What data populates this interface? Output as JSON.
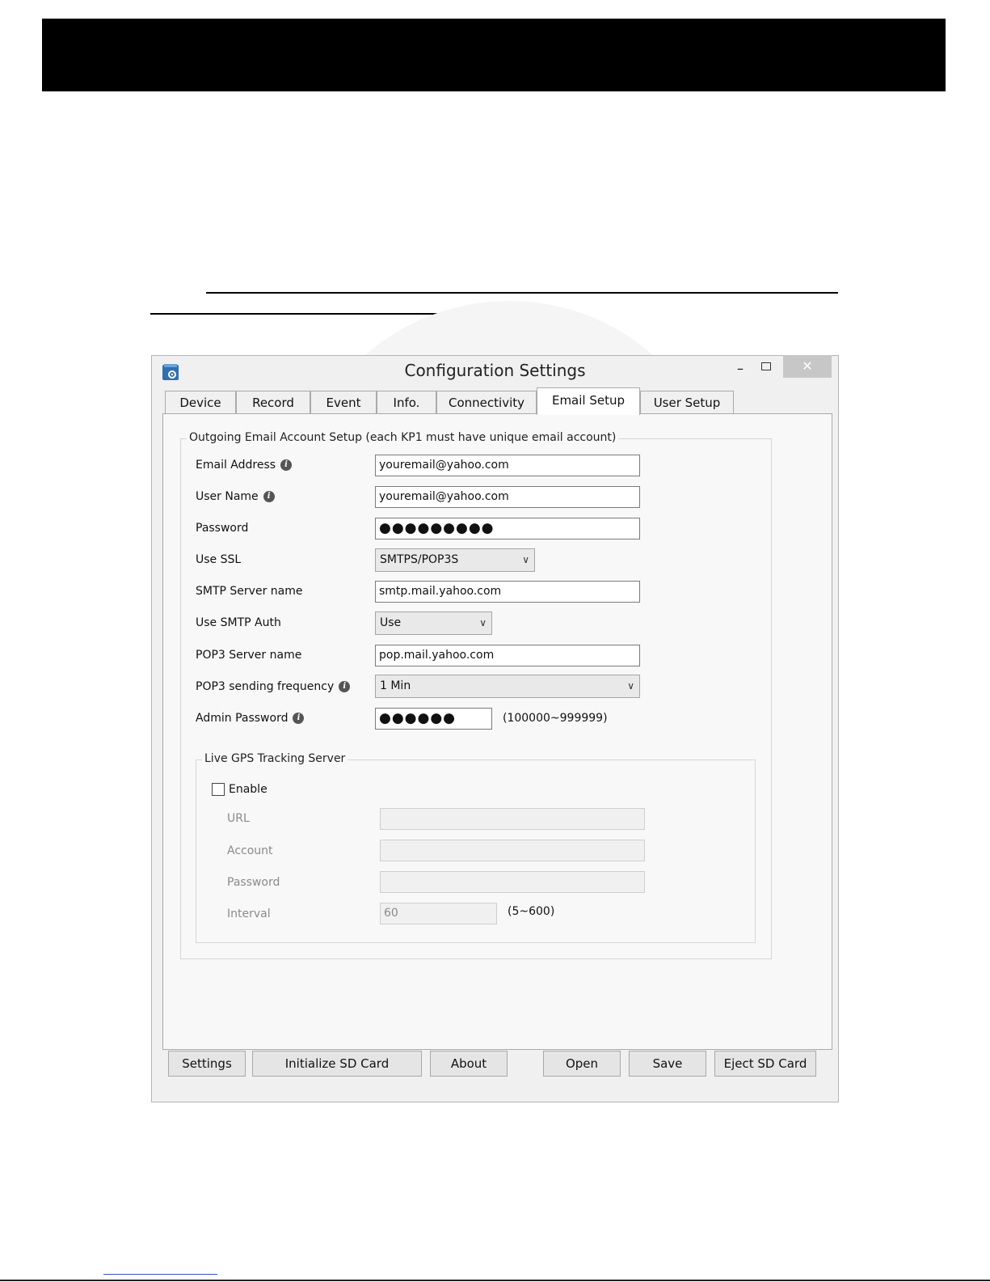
{
  "window": {
    "title": "Configuration Settings",
    "min_glyph": "–",
    "close_glyph": "✕"
  },
  "tabs": [
    "Device",
    "Record",
    "Event",
    "Info.",
    "Connectivity",
    "Email Setup",
    "User Setup"
  ],
  "active_tab": "Email Setup",
  "email_group": {
    "legend": "Outgoing Email Account Setup (each KP1 must have unique email account)",
    "email_address": {
      "label": "Email Address",
      "value": "youremail@yahoo.com"
    },
    "user_name": {
      "label": "User Name",
      "value": "youremail@yahoo.com"
    },
    "password": {
      "label": "Password",
      "value": "●●●●●●●●●"
    },
    "use_ssl": {
      "label": "Use SSL",
      "value": "SMTPS/POP3S"
    },
    "smtp_server": {
      "label": "SMTP Server name",
      "value": "smtp.mail.yahoo.com"
    },
    "smtp_auth": {
      "label": "Use SMTP Auth",
      "value": "Use"
    },
    "pop3_server": {
      "label": "POP3 Server name",
      "value": "pop.mail.yahoo.com"
    },
    "pop3_freq": {
      "label": "POP3 sending frequency",
      "value": "1 Min"
    },
    "admin_password": {
      "label": "Admin Password",
      "value": "●●●●●●",
      "hint": "(100000~999999)"
    }
  },
  "gps_group": {
    "legend": "Live GPS Tracking Server",
    "enable_label": "Enable",
    "enabled": false,
    "url": {
      "label": "URL",
      "value": ""
    },
    "account": {
      "label": "Account",
      "value": ""
    },
    "password": {
      "label": "Password",
      "value": ""
    },
    "interval": {
      "label": "Interval",
      "value": "60",
      "hint": "(5~600)"
    }
  },
  "buttons": {
    "settings": "Settings",
    "init_sd": "Initialize SD Card",
    "about": "About",
    "open": "Open",
    "save": "Save",
    "eject_sd": "Eject SD Card"
  },
  "colors": {
    "close_button": "#c7c7c7",
    "page_header_bar": "#000000",
    "info_icon": "#555555"
  }
}
